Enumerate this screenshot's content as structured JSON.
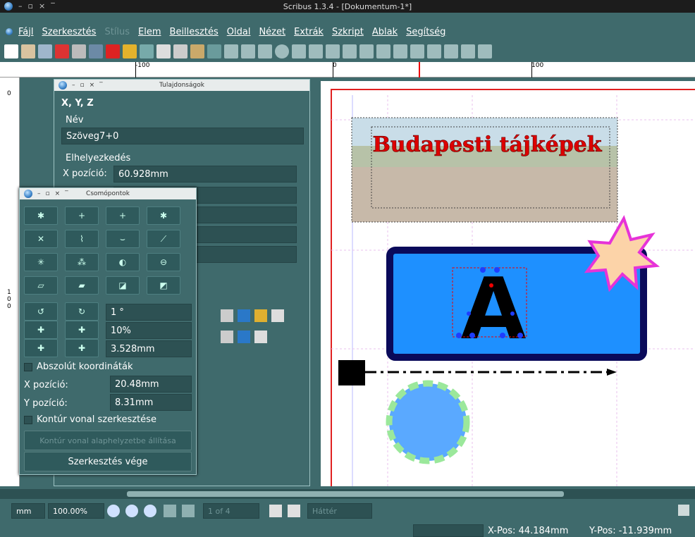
{
  "window": {
    "title": "Scribus 1.3.4 - [Dokumentum-1*]"
  },
  "menubar": {
    "items": [
      "Fájl",
      "Szerkesztés",
      "Stílus",
      "Elem",
      "Beillesztés",
      "Oldal",
      "Nézet",
      "Extrák",
      "Szkript",
      "Ablak",
      "Segítség"
    ]
  },
  "rulers": {
    "h_labels": [
      "-100",
      "0",
      "100"
    ],
    "v_labels": [
      "0",
      "1",
      "0",
      "0"
    ]
  },
  "properties_panel": {
    "title": "Tulajdonságok",
    "section": "X, Y, Z",
    "name_label": "Név",
    "name_value": "Szöveg7+0",
    "placement_label": "Elhelyezkedés",
    "x_label": "X pozíció:",
    "x_value": "60.928mm"
  },
  "nodes_panel": {
    "title": "Csomópontok",
    "rotate_value": "1 °",
    "scale_percent": "10%",
    "scale_mm": "3.528mm",
    "absolute_coords_label": "Abszolút koordináták",
    "x_label": "X pozíció:",
    "x_value": "20.48mm",
    "y_label": "Y pozíció:",
    "y_value": "8.31mm",
    "contour_label": "Kontúr vonal szerkesztése",
    "reset_contour_label": "Kontúr vonal alaphelyzetbe állítása",
    "end_edit_label": "Szerkesztés vége"
  },
  "canvas": {
    "title_text": "Budapesti tájképek",
    "glyph": "A"
  },
  "statusbar": {
    "unit": "mm",
    "zoom": "100.00%",
    "page": "1 of 4",
    "layer": "Háttér",
    "xpos": "X-Pos: 44.184mm",
    "ypos": "Y-Pos: -11.939mm"
  },
  "colors": {
    "accent_red": "#d02020",
    "panel_bg": "#3f6a6c",
    "field_bg": "#2d5153",
    "blue_rect": "#1e90ff",
    "dark_navy": "#0a0a5a",
    "star_fill": "#fcd3a8",
    "star_stroke": "#e633d8",
    "circle_fill": "#5aa9ff",
    "circle_stroke": "#9be89b"
  }
}
